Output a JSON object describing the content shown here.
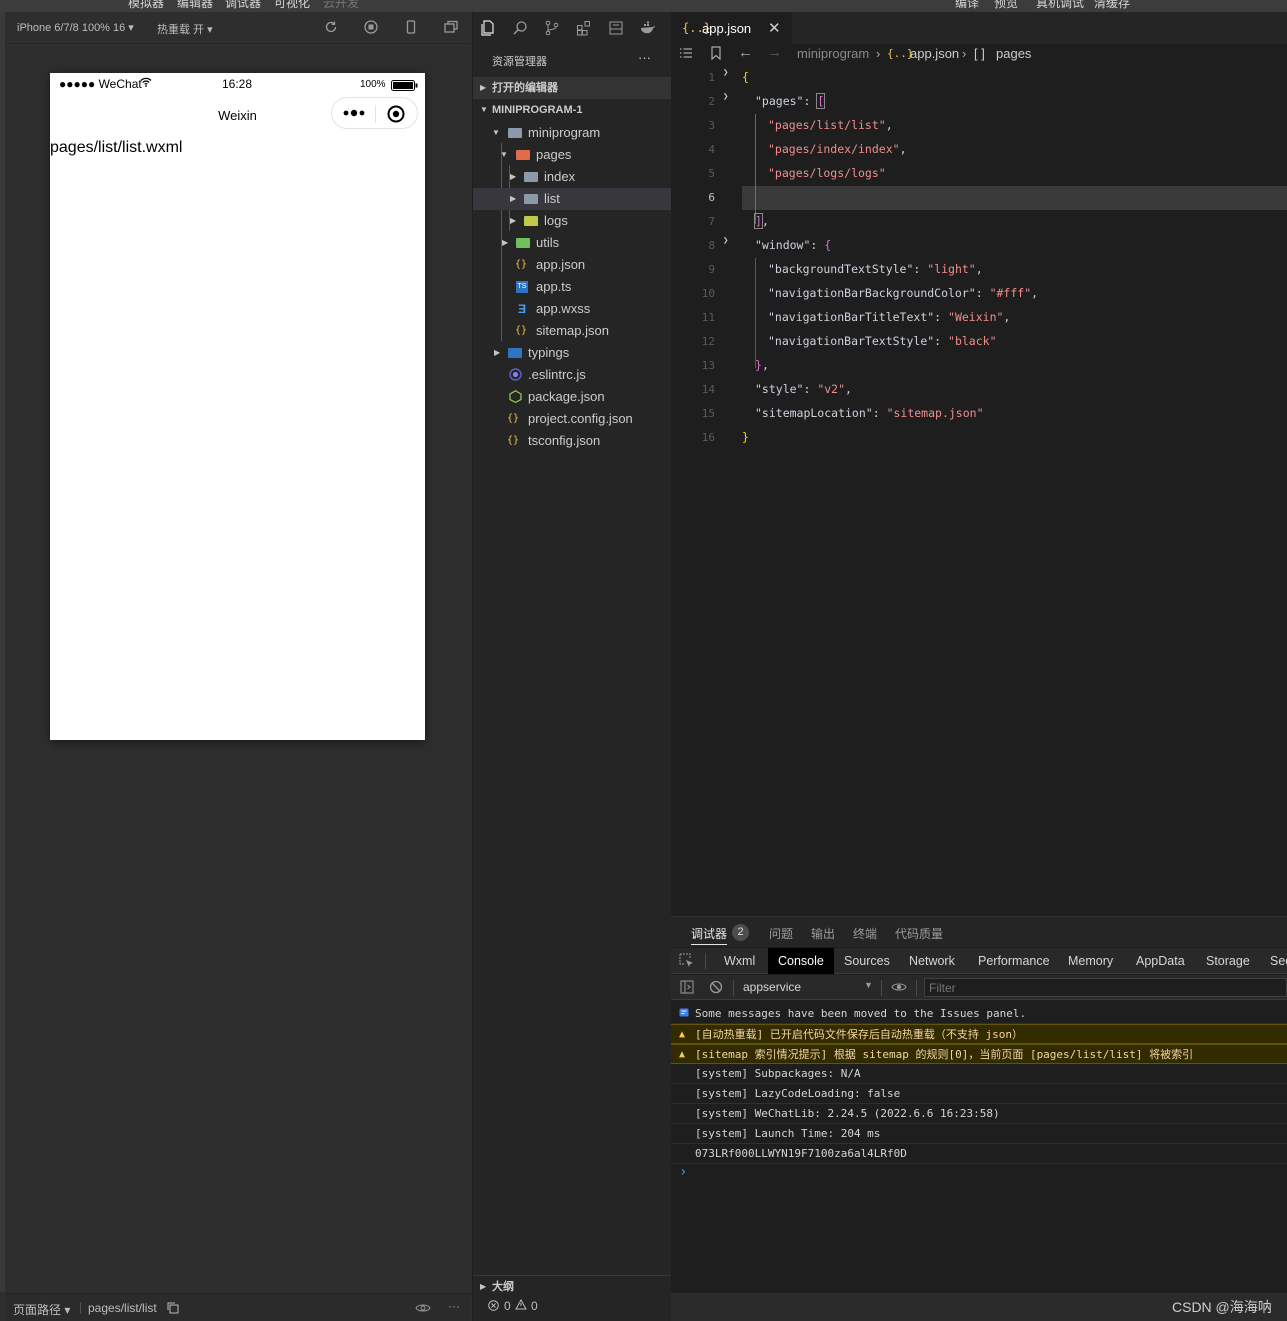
{
  "menu": {
    "items": [
      "模拟器",
      "编辑器",
      "调试器",
      "可视化",
      "云开发"
    ],
    "right_items": [
      "编译",
      "预览",
      "真机调试",
      "清缓存"
    ]
  },
  "simulator": {
    "device_label": "iPhone 6/7/8 100% 16 ▾",
    "hot_reload_label": "热重载 开 ▾",
    "status": {
      "carrier": "●●●●● WeChat",
      "time": "16:28",
      "battery": "100%"
    },
    "nav_title": "Weixin",
    "page_content": "pages/list/list.wxml",
    "footer": {
      "path_label": "页面路径 ▾",
      "path_value": "pages/list/list"
    }
  },
  "explorer": {
    "title": "资源管理器",
    "more": "···",
    "open_editors": "打开的编辑器",
    "project": "MINIPROGRAM-1",
    "tree": {
      "miniprogram": "miniprogram",
      "pages": "pages",
      "index": "index",
      "list": "list",
      "logs": "logs",
      "utils": "utils",
      "app_json": "app.json",
      "app_ts": "app.ts",
      "app_wxss": "app.wxss",
      "sitemap_json": "sitemap.json",
      "typings": "typings",
      "eslintrc": ".eslintrc.js",
      "package_json": "package.json",
      "project_config": "project.config.json",
      "tsconfig": "tsconfig.json"
    },
    "outline": "大纲",
    "errors": "0",
    "warnings": "0"
  },
  "editor": {
    "tab": {
      "icon": "{..}",
      "name": "app.json"
    },
    "breadcrumb": {
      "folder": "miniprogram",
      "file": "app.json",
      "symbol": "pages",
      "file_icon": "{..}",
      "symbol_icon": "[ ]"
    },
    "line_numbers": [
      "1",
      "2",
      "3",
      "4",
      "5",
      "6",
      "7",
      "8",
      "9",
      "10",
      "11",
      "12",
      "13",
      "14",
      "15",
      "16"
    ],
    "code": {
      "pages_key": "\"pages\"",
      "page1": "\"pages/list/list\"",
      "page2": "\"pages/index/index\"",
      "page3": "\"pages/logs/logs\"",
      "window_key": "\"window\"",
      "bts_key": "\"backgroundTextStyle\"",
      "bts_val": "\"light\"",
      "nbbc_key": "\"navigationBarBackgroundColor\"",
      "nbbc_val": "\"#fff\"",
      "nbtt_key": "\"navigationBarTitleText\"",
      "nbtt_val": "\"Weixin\"",
      "nbts_key": "\"navigationBarTextStyle\"",
      "nbts_val": "\"black\"",
      "style_key": "\"style\"",
      "style_val": "\"v2\"",
      "sitemap_key": "\"sitemapLocation\"",
      "sitemap_val": "\"sitemap.json\""
    }
  },
  "panel": {
    "tabs": [
      "调试器",
      "问题",
      "输出",
      "终端",
      "代码质量"
    ],
    "debugger_badge": "2",
    "devtools_tabs": [
      "Wxml",
      "Console",
      "Sources",
      "Network",
      "Performance",
      "Memory",
      "AppData",
      "Storage",
      "Sec"
    ],
    "context": "appservice",
    "filter_placeholder": "Filter",
    "messages": [
      "Some messages have been moved to the Issues panel.",
      "[自动热重载] 已开启代码文件保存后自动热重载（不支持 json）",
      "[sitemap 索引情况提示] 根据 sitemap 的规则[0]，当前页面 [pages/list/list] 将被索引",
      "[system] Subpackages: N/A",
      "[system] LazyCodeLoading: false",
      "[system] WeChatLib: 2.24.5 (2022.6.6 16:23:58)",
      "[system] Launch Time: 204 ms",
      "073LRf000LLWYN19F7100za6al4LRf0D"
    ],
    "prompt": "›"
  },
  "watermark": "CSDN @海海呐",
  "colors": {
    "accent": "#0e639c",
    "warning_bg": "#332b00",
    "string": "#f08d8d"
  }
}
